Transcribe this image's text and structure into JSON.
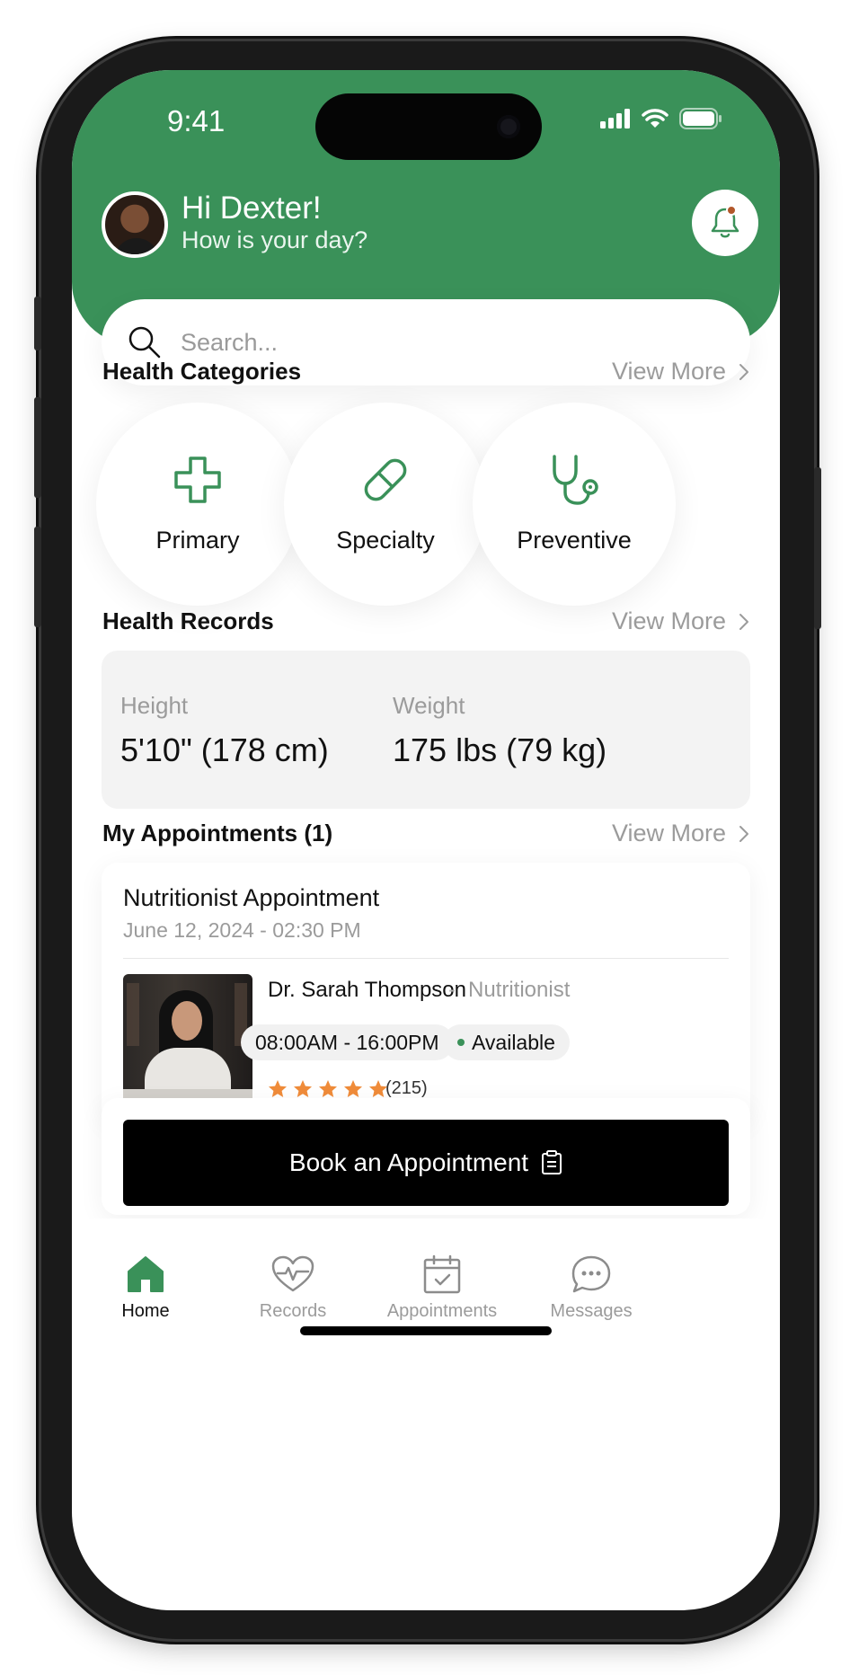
{
  "status_bar": {
    "time": "9:41"
  },
  "header": {
    "greeting": "Hi Dexter!",
    "subtitle": "How is your day?"
  },
  "search": {
    "placeholder": "Search..."
  },
  "health_categories": {
    "title": "Health Categories",
    "view_more": "View More",
    "items": [
      {
        "label": "Primary",
        "icon": "medical-cross-icon"
      },
      {
        "label": "Specialty",
        "icon": "pill-icon"
      },
      {
        "label": "Preventive",
        "icon": "stethoscope-icon"
      }
    ]
  },
  "health_records": {
    "title": "Health Records",
    "view_more": "View More",
    "height_label": "Height",
    "height_value": "5'10\" (178 cm)",
    "weight_label": "Weight",
    "weight_value": "175 lbs (79 kg)"
  },
  "appointments": {
    "title": "My Appointments (1)",
    "view_more": "View More",
    "card": {
      "title": "Nutritionist Appointment",
      "date": "June 12, 2024 - 02:30 PM",
      "doctor_name": "Dr. Sarah Thompson",
      "separator": "-",
      "doctor_role": "Nutritionist",
      "hours": "08:00AM - 16:00PM",
      "availability": "Available",
      "rating": 5,
      "reviews": "(215)"
    }
  },
  "book_button": {
    "label": "Book an Appointment"
  },
  "tabbar": {
    "items": [
      {
        "label": "Home",
        "icon": "home-icon",
        "active": true
      },
      {
        "label": "Records",
        "icon": "heart-pulse-icon",
        "active": false
      },
      {
        "label": "Appointments",
        "icon": "calendar-check-icon",
        "active": false
      },
      {
        "label": "Messages",
        "icon": "chat-bubble-icon",
        "active": false
      }
    ]
  },
  "colors": {
    "brand_green": "#3a9159",
    "star_orange": "#f08c3a",
    "notification_dot": "#b2572a"
  }
}
